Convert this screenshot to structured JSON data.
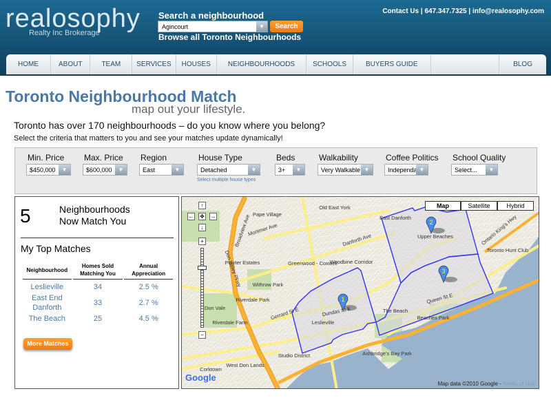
{
  "header": {
    "logo": "realosophy",
    "logo_sub": "Realty Inc Brokerage",
    "search_label": "Search a neighbourhood",
    "search_value": "Agincourt",
    "search_button": "Search",
    "browse_link": "Browse all Toronto Neighbourhoods",
    "contact": "Contact Us | 647.347.7325 |  info@realosophy.com"
  },
  "nav": [
    "HOME",
    "ABOUT",
    "TEAM",
    "SERVICES",
    "HOUSES",
    "NEIGHBOURHOODS",
    "SCHOOLS",
    "BUYERS GUIDE",
    "BLOG"
  ],
  "page": {
    "title": "Toronto Neighbourhood Match",
    "subtitle": "map out your lifestyle.",
    "question": "Toronto has over 170 neighbourhoods – do you know where you belong?",
    "instruction": "Select the criteria that matters to you and see your matches update dynamically!"
  },
  "filters": [
    {
      "label": "Min. Price",
      "value": "$450,000"
    },
    {
      "label": "Max. Price",
      "value": "$600,000"
    },
    {
      "label": "Region",
      "value": "East"
    },
    {
      "label": "House Type",
      "value": "Detached",
      "note": "Select multiple house types"
    },
    {
      "label": "Beds",
      "value": "3+"
    },
    {
      "label": "Walkability",
      "value": "Very Walkable"
    },
    {
      "label": "Coffee Politics",
      "value": "Independant"
    },
    {
      "label": "School Quality",
      "value": "Select..."
    }
  ],
  "results": {
    "count": "5",
    "count_label_1": "Neighbourhoods",
    "count_label_2": "Now Match You",
    "top_title": "My Top Matches",
    "columns": [
      "Neighbourhood",
      "Homes Sold Matching You",
      "Annual Appreciation"
    ],
    "rows": [
      [
        "Leslieville",
        "34",
        "2.5 %"
      ],
      [
        "East End Danforth",
        "33",
        "2.7 %"
      ],
      [
        "The Beach",
        "25",
        "4.5 %"
      ]
    ],
    "more_button": "More Matches"
  },
  "map": {
    "types": [
      "Map",
      "Satellite",
      "Hybrid"
    ],
    "selected_type": "Map",
    "attribution": "Map data ©2010 Google - ",
    "terms": "Terms of Use",
    "pins": [
      "1",
      "2",
      "3"
    ],
    "labels": [
      "Old East York",
      "Pape Village",
      "Playter Estates",
      "Greenwood - Coxwell",
      "Woodbine Corridor",
      "East Danforth",
      "Upper Beaches",
      "Don Vale",
      "Leslieville",
      "The Beach",
      "Beaches Park",
      "Ashbridge's Bay Park",
      "Studio District",
      "West Don Lands",
      "Corktown",
      "Toronto Hunt Club",
      "Riverdale Park",
      "Riverdale Farm",
      "Withrow Park",
      "Danforth Ave",
      "Queen St E",
      "Gerrard St E",
      "Dundas St E",
      "Don Valley Pkwy",
      "Mortimer Ave",
      "Broadview Ave",
      "Ontario King's Hwy"
    ],
    "colors": {
      "lake": "#99b3cc",
      "highway": "#f9b233",
      "arterial": "#fcef8a",
      "boundary": "#3333ee",
      "park": "#c9dfaf"
    }
  }
}
